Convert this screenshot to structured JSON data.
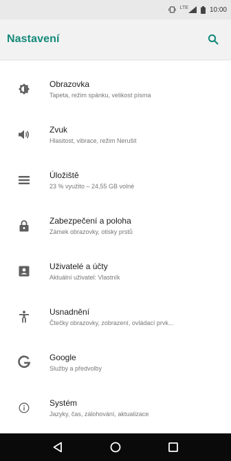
{
  "status_bar": {
    "network": "LTE",
    "time": "10:00"
  },
  "header": {
    "title": "Nastavení",
    "search_icon": "search-icon"
  },
  "settings": [
    {
      "icon": "brightness-icon",
      "title": "Obrazovka",
      "subtitle": "Tapeta, režim spánku, velikost písma"
    },
    {
      "icon": "volume-icon",
      "title": "Zvuk",
      "subtitle": "Hlasitost, vibrace, režim Nerušit"
    },
    {
      "icon": "storage-icon",
      "title": "Úložiště",
      "subtitle": "23 % využito – 24,55 GB volné"
    },
    {
      "icon": "lock-icon",
      "title": "Zabezpečení a poloha",
      "subtitle": "Zámek obrazovky, otisky prstů"
    },
    {
      "icon": "account-icon",
      "title": "Uživatelé a účty",
      "subtitle": "Aktuální uživatel: Vlastník"
    },
    {
      "icon": "accessibility-icon",
      "title": "Usnadnění",
      "subtitle": "Čtečky obrazovky, zobrazení, ovládací prvk..."
    },
    {
      "icon": "google-icon",
      "title": "Google",
      "subtitle": "Služby a předvolby"
    },
    {
      "icon": "info-icon",
      "title": "Systém",
      "subtitle": "Jazyky, čas, zálohování, aktualizace"
    }
  ],
  "nav": {
    "back_icon": "back-icon",
    "home_icon": "home-icon",
    "recents_icon": "recents-icon"
  },
  "colors": {
    "accent": "#14897a",
    "status_bar_bg": "#e9e9e9",
    "app_bar_bg": "#f2f2f2",
    "nav_bar_bg": "#0a0a0a",
    "icon": "#5f5f5f"
  }
}
